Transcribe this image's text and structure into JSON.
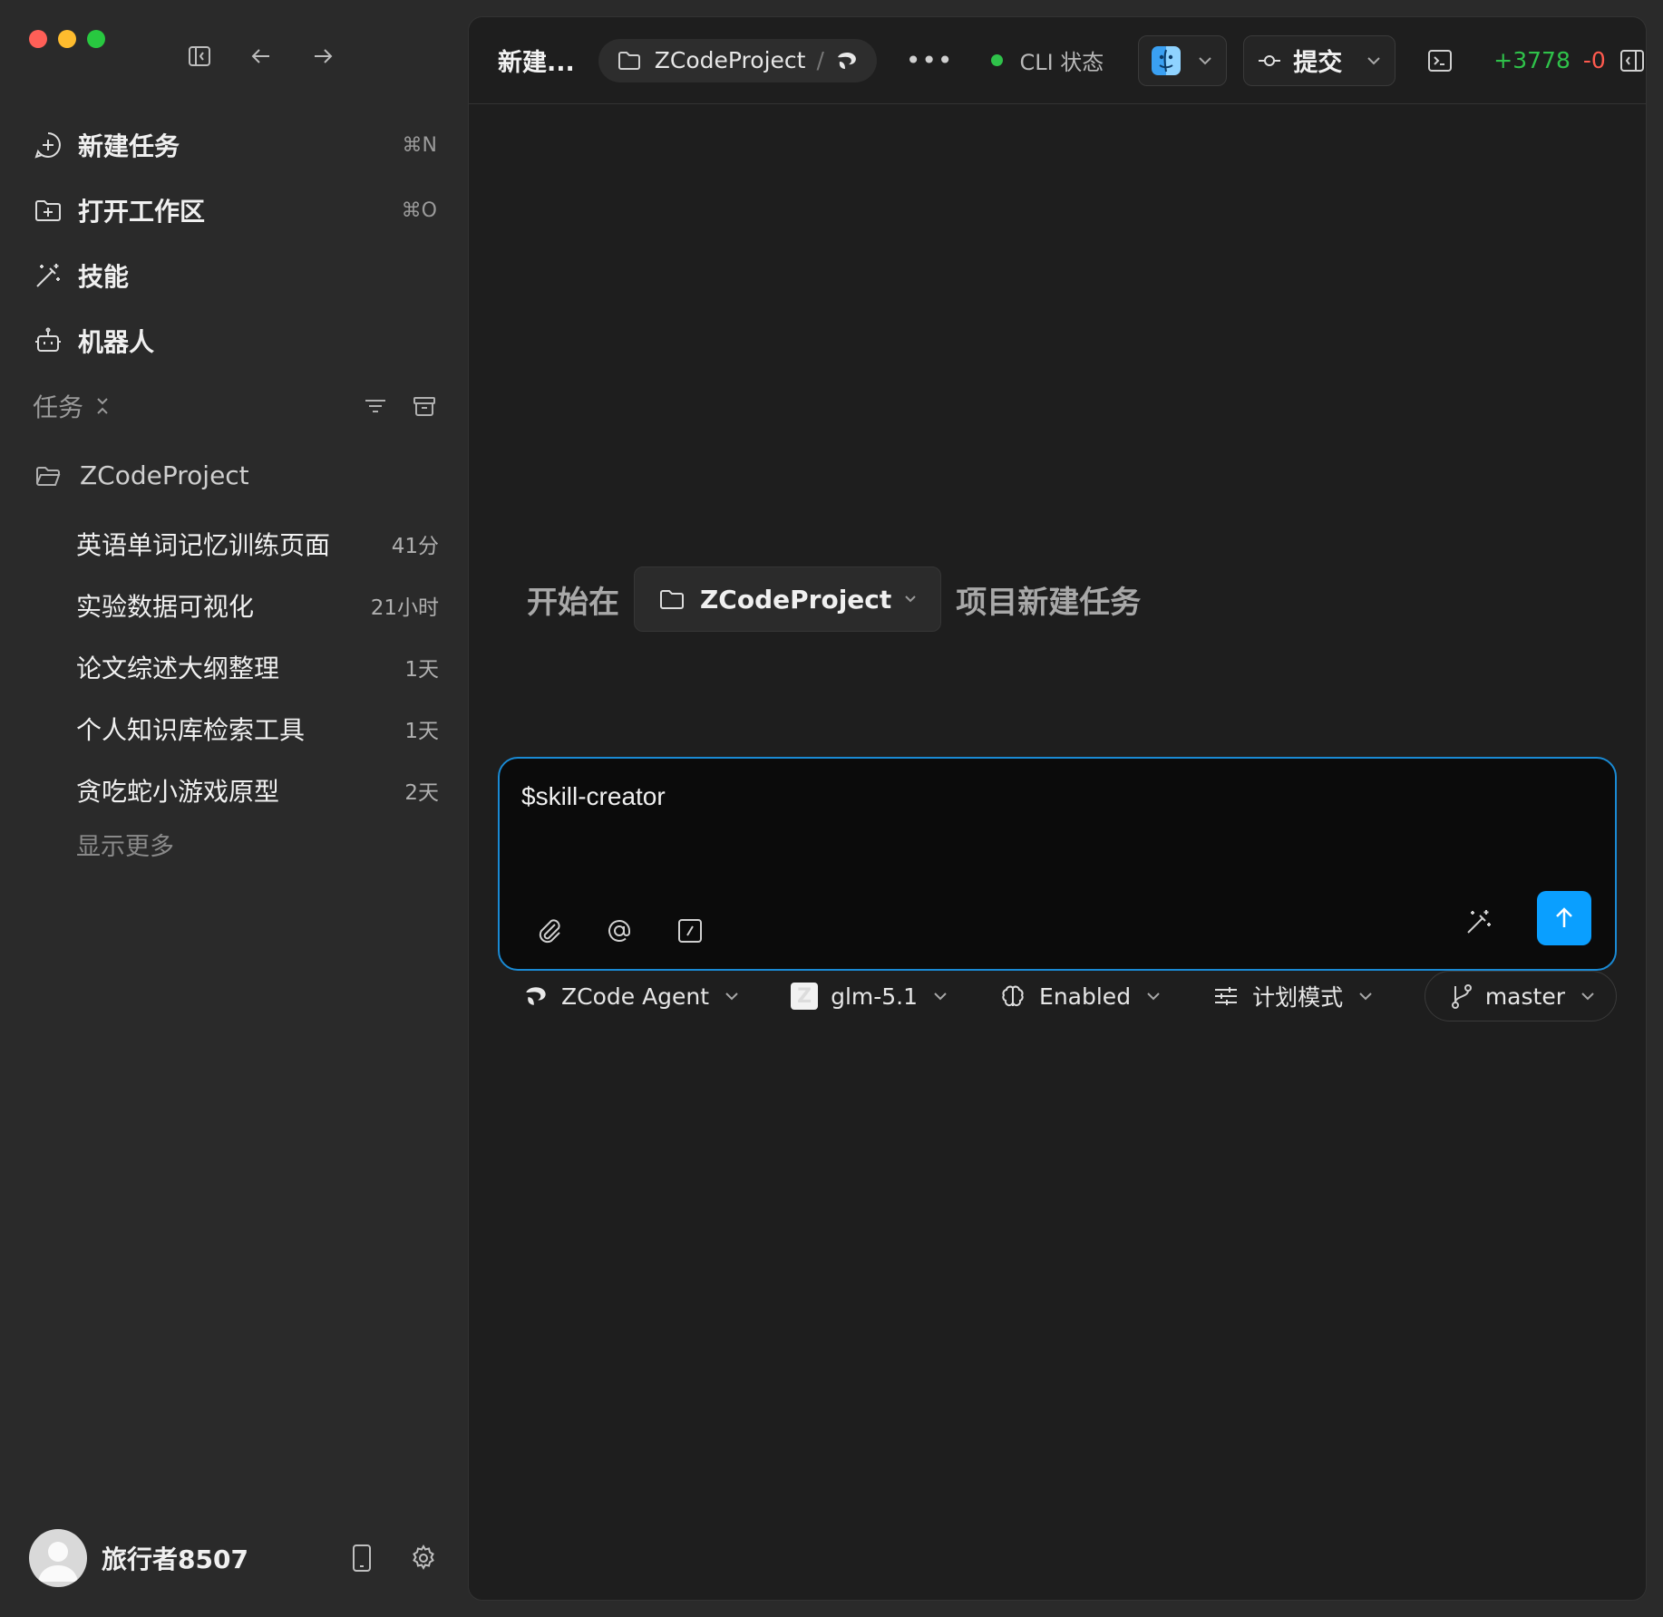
{
  "sidebar": {
    "nav": [
      {
        "label": "新建任务",
        "shortcut": "⌘N",
        "icon": "plus-circle-icon"
      },
      {
        "label": "打开工作区",
        "shortcut": "⌘O",
        "icon": "folder-plus-icon"
      },
      {
        "label": "技能",
        "shortcut": "",
        "icon": "magic-wand-icon"
      },
      {
        "label": "机器人",
        "shortcut": "",
        "icon": "robot-icon"
      }
    ],
    "tasks_header": "任务",
    "project": "ZCodeProject",
    "tasks": [
      {
        "name": "英语单词记忆训练页面",
        "time": "41分"
      },
      {
        "name": "实验数据可视化",
        "time": "21小时"
      },
      {
        "name": "论文综述大纲整理",
        "time": "1天"
      },
      {
        "name": "个人知识库检索工具",
        "time": "1天"
      },
      {
        "name": "贪吃蛇小游戏原型",
        "time": "2天"
      }
    ],
    "show_more": "显示更多",
    "user_name": "旅行者8507"
  },
  "topbar": {
    "title": "新建...",
    "breadcrumb_project": "ZCodeProject",
    "breadcrumb_sep": "/",
    "cli_status": "CLI 状态",
    "commit_label": "提交",
    "additions": "+3778",
    "deletions": "-0"
  },
  "start": {
    "prefix": "开始在",
    "project": "ZCodeProject",
    "suffix": "项目新建任务"
  },
  "composer": {
    "value": "$skill-creator"
  },
  "options": {
    "agent": "ZCode Agent",
    "model": "glm-5.1",
    "thinking": "Enabled",
    "mode": "计划模式",
    "branch": "master"
  },
  "colors": {
    "accent": "#0a9fff",
    "status_green": "#2fc24a",
    "deletion_red": "#ff5a4e"
  }
}
